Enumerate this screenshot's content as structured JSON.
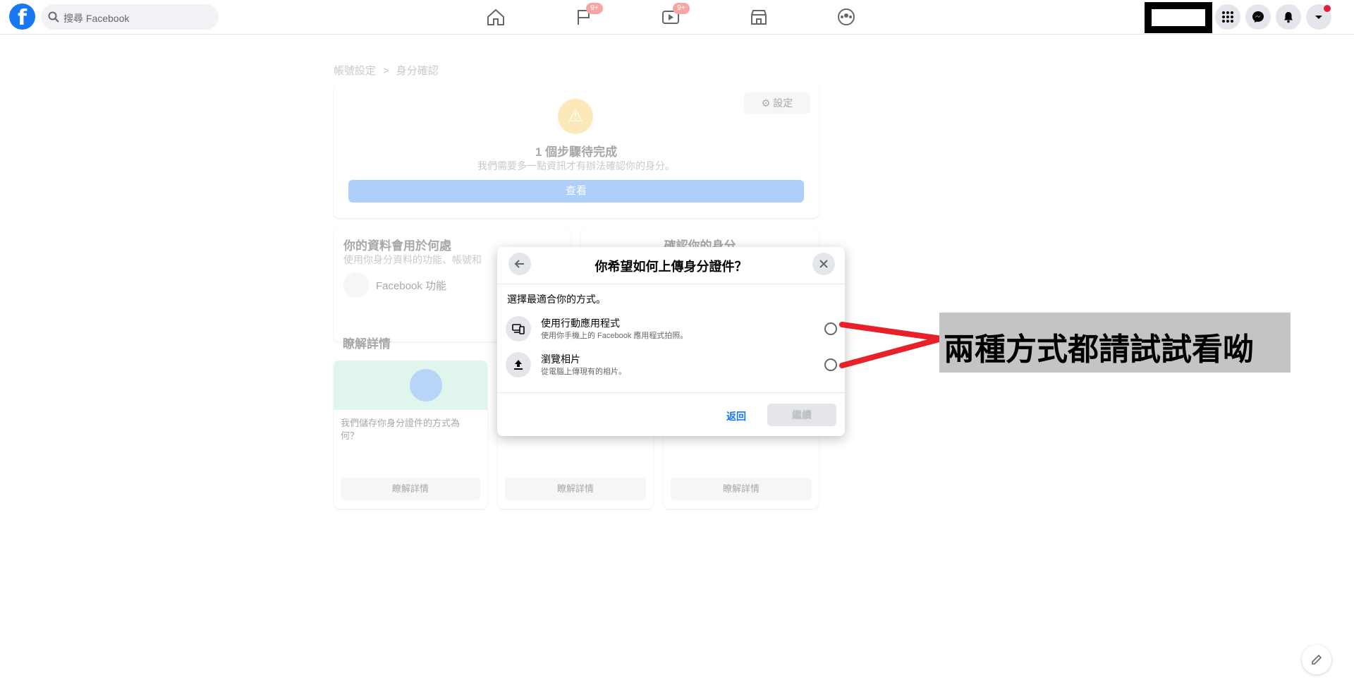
{
  "topbar": {
    "logo": "f",
    "search_placeholder": "搜尋 Facebook",
    "nav": [
      {
        "icon": "home-icon",
        "badge": ""
      },
      {
        "icon": "flag-icon",
        "badge": "9+"
      },
      {
        "icon": "watch-icon",
        "badge": "9+"
      },
      {
        "icon": "marketplace-icon",
        "badge": ""
      },
      {
        "icon": "groups-icon",
        "badge": ""
      }
    ],
    "right_icons": [
      "menu-grid-icon",
      "messenger-icon",
      "bell-icon",
      "account-caret-icon"
    ]
  },
  "background": {
    "breadcrumb": {
      "parent": "帳號設定",
      "separator": ">",
      "current": "身分確認"
    },
    "status_card": {
      "settings_label": "設定",
      "title": "1 個步驟待完成",
      "subtitle": "我們需要多一點資訊才有辦法確認你的身分。",
      "view_button": "查看"
    },
    "data_card": {
      "title": "你的資料會用於何處",
      "subtitle": "使用你身分資料的功能、帳號和",
      "item": "Facebook 功能"
    },
    "verify_card": {
      "title": "確認你的身分"
    },
    "learn": {
      "title": "瞭解詳情",
      "cards": [
        {
          "text": "我們儲存你身分證件的方式為何？",
          "button": "瞭解詳情"
        },
        {
          "text": "",
          "button": "瞭解詳情"
        },
        {
          "text": "",
          "button": "瞭解詳情"
        }
      ]
    }
  },
  "modal": {
    "title": "你希望如何上傳身分證件？",
    "prompt": "選擇最適合你的方式。",
    "options": [
      {
        "title": "使用行動應用程式",
        "subtitle": "使用你手機上的 Facebook 應用程式拍照。",
        "icon": "devices-icon"
      },
      {
        "title": "瀏覽相片",
        "subtitle": "從電腦上傳現有的相片。",
        "icon": "upload-icon"
      }
    ],
    "back_label": "返回",
    "continue_label": "繼續"
  },
  "annotation": {
    "text": "兩種方式都請試試看呦",
    "arrow_color": "#e8202a",
    "box_color": "#c4c4c4"
  },
  "colors": {
    "brand": "#1877f2",
    "warning": "#f5c33b",
    "badge": "#e41e3f"
  }
}
